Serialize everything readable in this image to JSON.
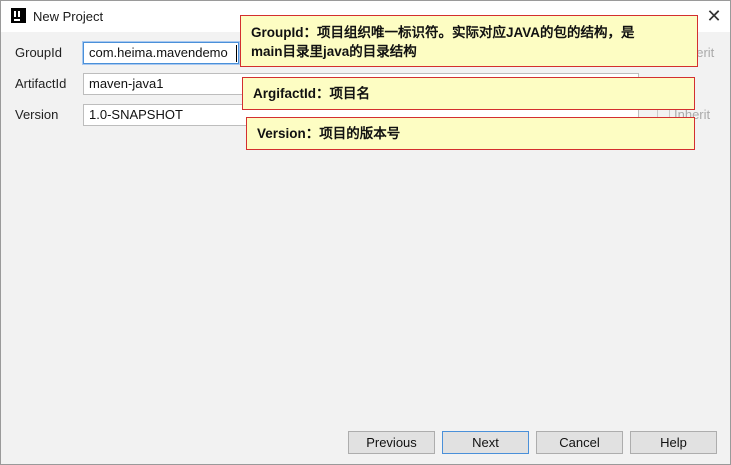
{
  "window": {
    "title": "New Project",
    "close_glyph": "✕"
  },
  "form": {
    "groupid": {
      "label": "GroupId",
      "value": "com.heima.mavendemo"
    },
    "artifactid": {
      "label": "ArtifactId",
      "value": "maven-java1"
    },
    "version": {
      "label": "Version",
      "value": "1.0-SNAPSHOT"
    },
    "inherit_label": "Inherit",
    "inherit_label_partial": "herit"
  },
  "annotations": {
    "groupid_line1": "GroupId：项目组织唯一标识符。实际对应JAVA的包的结构，是",
    "groupid_line2": "main目录里java的目录结构",
    "artifactid": "ArgifactId：项目名",
    "version": "Version：项目的版本号"
  },
  "buttons": {
    "previous": "Previous",
    "next": "Next",
    "cancel": "Cancel",
    "help": "Help"
  },
  "colors": {
    "tooltip_bg": "#fdfdc3",
    "tooltip_border": "#d32f2f",
    "focus_border": "#4a90d9"
  },
  "icons": {
    "app": "intellij-app-icon",
    "close": "close-icon",
    "checkbox": "checkbox-icon"
  }
}
